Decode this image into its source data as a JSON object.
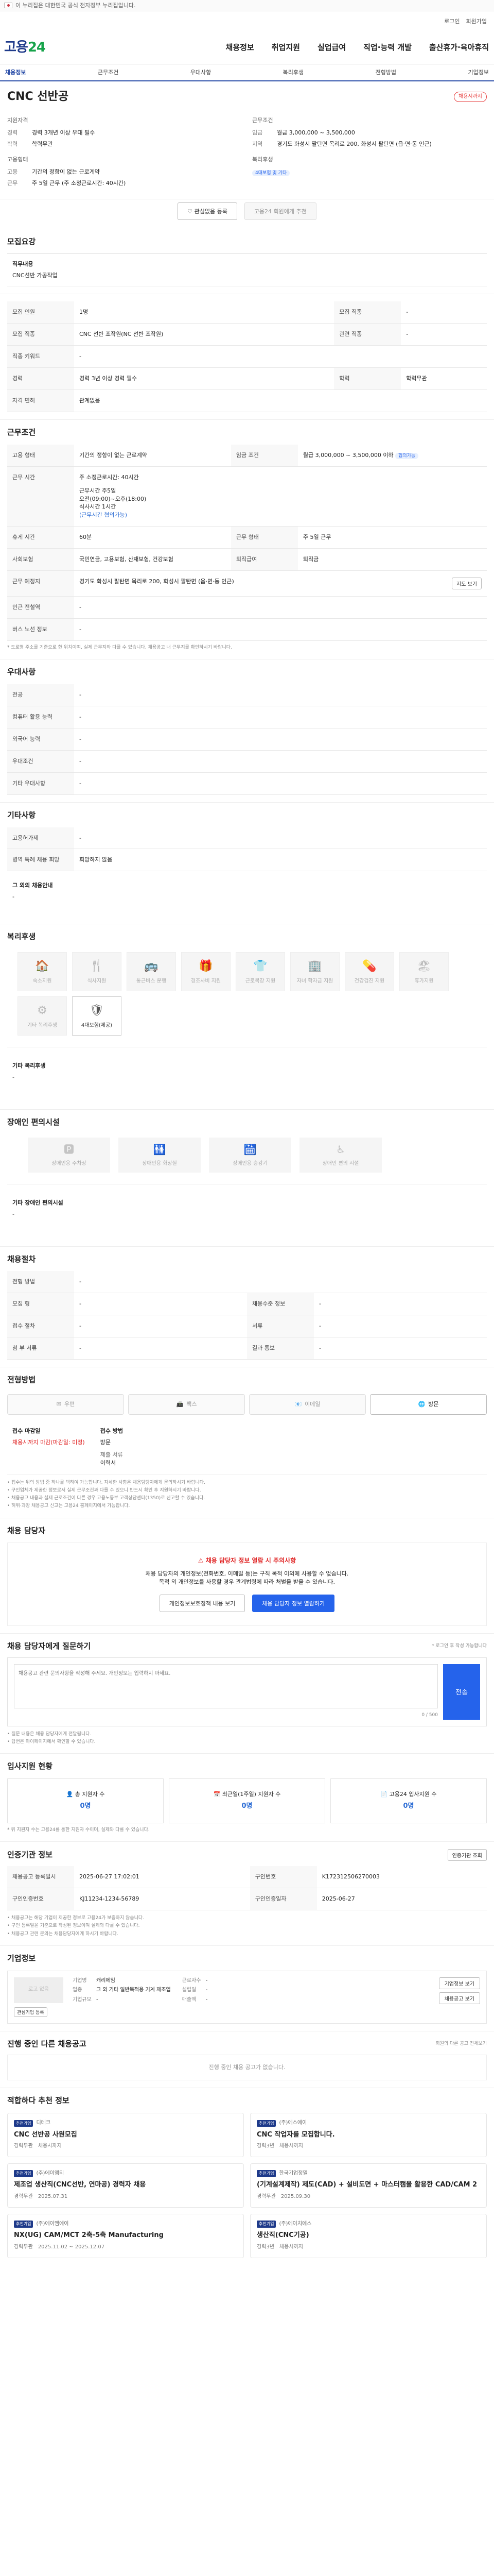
{
  "banner": {
    "text": "이 누리집은 대한민국 공식 전자정부 누리집입니다."
  },
  "util": {
    "links": [
      "로그인",
      "회원가입"
    ]
  },
  "header": {
    "logo_main": "고용",
    "logo_sub": "24",
    "gnb": [
      "채용정보",
      "취업지원",
      "실업급여",
      "직업·능력 개발",
      "출산휴가·육아휴직"
    ]
  },
  "tabs": [
    "채용정보",
    "근무조건",
    "우대사항",
    "복리후생",
    "전형방법",
    "기업정보"
  ],
  "job": {
    "title": "CNC 선반공",
    "deadline_badge": "채용시까지",
    "summary_left": {
      "heading": "지원자격",
      "rows": [
        {
          "k": "경력",
          "v": "경력 3개년 이상 우대 필수"
        },
        {
          "k": "학력",
          "v": "학력무관"
        }
      ],
      "heading2": "고용형태",
      "rows2": [
        {
          "k": "고용",
          "v": "기간의 정함이 없는 근로계약"
        },
        {
          "k": "근무",
          "v": "주 5일 근무 (주 소정근로시간: 40시간)"
        }
      ]
    },
    "summary_right": {
      "heading": "근무조건",
      "rows": [
        {
          "k": "임금",
          "v": "월급 3,000,000 ~ 3,500,000"
        },
        {
          "k": "지역",
          "v": "경기도 화성시 팔탄면 목리로 200, 화성시 팔탄면 (읍·면·동 인근)"
        }
      ],
      "heading2": "복리후생",
      "tag": "4대보험 및 기타"
    },
    "apply_button": "관심없음 등록",
    "interest_button": "고용24 회원에게 추천"
  },
  "duties": {
    "title": "모집요강",
    "label": "직무내용",
    "text": "CNC선반 가공작업"
  },
  "recruit_table": [
    {
      "h": "모집 인원",
      "v": "1명",
      "h2": "모집 직종",
      "v2": "-"
    },
    {
      "h": "모집 직종",
      "v": "CNC 선반 조작원(NC 선반 조작원)",
      "h2": "관련 직종",
      "v2": "-"
    },
    {
      "h": "직종 키워드",
      "v": "-",
      "h2": "",
      "v2": ""
    },
    {
      "h": "경력",
      "v": "경력 3년 이상 경력 필수",
      "h2": "학력",
      "v2": "학력무관"
    },
    {
      "h": "자격 면허",
      "v": "관계없음",
      "h2": "",
      "v2": ""
    }
  ],
  "conditions": {
    "title": "근무조건",
    "rows": [
      {
        "h": "고용 형태",
        "v": "기간의 정함이 없는 근로계약",
        "h2": "임금 조건",
        "v2": "월급 3,000,000 ~ 3,500,000 이하",
        "v2tag": "협의가능"
      },
      {
        "h": "근무 시간",
        "v": "주 소정근로시간: 40시간",
        "lines": [
          "근무시간 주5일",
          "오전(09:00)~오후(18:00)",
          "식사시간 1시간",
          "(근무시간 협의가능)"
        ],
        "h2": "",
        "v2": ""
      },
      {
        "h": "휴게 시간",
        "v": "60분",
        "h2": "근무 형태",
        "v2": "주 5일 근무"
      },
      {
        "h": "사회보험",
        "v": "국민연금, 고용보험, 산재보험, 건강보험",
        "h2": "퇴직급여",
        "v2": "퇴직금"
      },
      {
        "h": "근무 예정지",
        "v": "경기도 화성시 팔탄면 목리로 200, 화성시 팔탄면 (읍·면·동 인근)",
        "h2": "",
        "v2": "",
        "map_btn": "지도 보기"
      },
      {
        "h": "인근 전철역",
        "v": "-",
        "h2": "",
        "v2": ""
      },
      {
        "h": "버스 노선 정보",
        "v": "-",
        "h2": "",
        "v2": ""
      }
    ],
    "note": "* 도로명 주소를 기준으로 한 위치이며, 실제 근무지와 다를 수 있습니다. 채용공고 내 근무지를 확인하시기 바랍니다."
  },
  "preference": {
    "title": "우대사항",
    "rows": [
      {
        "h": "전공",
        "v": "-"
      },
      {
        "h": "컴퓨터 활용 능력",
        "v": "-"
      },
      {
        "h": "외국어 능력",
        "v": "-"
      },
      {
        "h": "우대조건",
        "v": "-"
      },
      {
        "h": "기타 우대사항",
        "v": "-"
      }
    ]
  },
  "extra": {
    "title": "기타사항",
    "rows": [
      {
        "h": "고용허가제",
        "v": "-"
      },
      {
        "h": "병역 특례 채용 희망",
        "v": "희망하지 않음"
      }
    ],
    "sub": "그 외의 채용안내",
    "sub_text": "-"
  },
  "welfare": {
    "title": "복리후생",
    "cards": [
      {
        "icon": "🏠",
        "name": "숙소지원",
        "on": false
      },
      {
        "icon": "🍴",
        "name": "식사지원",
        "on": false
      },
      {
        "icon": "🚌",
        "name": "통근버스 운행",
        "on": false
      },
      {
        "icon": "🎁",
        "name": "경조사비 지원",
        "on": false
      },
      {
        "icon": "👕",
        "name": "근로복장 지원",
        "on": false
      },
      {
        "icon": "🏢",
        "name": "자녀 학자금 지원",
        "on": false
      },
      {
        "icon": "💊",
        "name": "건강검진 지원",
        "on": false
      },
      {
        "icon": "🏖",
        "name": "휴가지원",
        "on": false
      },
      {
        "icon": "⚙",
        "name": "기타 복리후생",
        "on": false
      },
      {
        "icon": "🛡",
        "name": "4대보험(제공)",
        "on": true
      }
    ],
    "other_title": "기타 복리후생",
    "other_text": "-"
  },
  "disabled": {
    "title": "장애인 편의시설",
    "cards": [
      {
        "icon": "🅿",
        "name": "장애인용 주차장"
      },
      {
        "icon": "🚻",
        "name": "장애인용 화장실"
      },
      {
        "icon": "🛗",
        "name": "장애인용 승강기"
      },
      {
        "icon": "♿",
        "name": "장애인 편의 시설"
      }
    ],
    "other_title": "기타 장애인 편의시설",
    "other_text": "-"
  },
  "process": {
    "title": "채용절차",
    "rows": [
      {
        "h": "전형 방법",
        "v": "-",
        "h2": "",
        "v2": ""
      },
      {
        "h": "모집 형",
        "v": "-",
        "h2": "채용수준 정보",
        "v2": "-"
      },
      {
        "h": "접수 절차",
        "v": "-",
        "h2": "서류",
        "v2": "-"
      },
      {
        "h": "첨 부 서류",
        "v": "-",
        "h2": "결과 통보",
        "v2": "-"
      }
    ]
  },
  "method": {
    "title": "전형방법",
    "tabs": [
      {
        "icon": "✉",
        "label": "우편",
        "on": false
      },
      {
        "icon": "📠",
        "label": "팩스",
        "on": false
      },
      {
        "icon": "📧",
        "label": "이메일",
        "on": false
      },
      {
        "icon": "🌐",
        "label": "방문",
        "on": true
      }
    ],
    "left_label": "접수 마감일",
    "left_value": "채용시까지 마감(마감일: 미정)",
    "right_label": "접수 방법",
    "right_lines": [
      "방문",
      "제출 서류",
      "이력서"
    ],
    "notices": [
      "• 접수는 위의 방법 중 하나를 택하여 가능합니다. 자세한 사항은 채용담당자에게 문의하시기 바랍니다.",
      "• 구인업체가 제공한 정보로서 실제 근무조건과 다를 수 있으니 반드시 확인 후 지원하시기 바랍니다.",
      "• 채용공고 내용과 실제 근로조건이 다른 경우 고용노동부 고객상담센터(1350)로 신고할 수 있습니다.",
      "• 허위·과장 채용공고 신고는 고용24 홈페이지에서 가능합니다."
    ]
  },
  "contact": {
    "title": "채용 담당자",
    "alert": "채용 담당자 정보 열람 시 주의사항",
    "text1": "채용 담당자의 개인정보(전화번호, 이메일 등)는 구직 목적 이외에 사용할 수 없습니다.",
    "text2": "목적 외 개인정보를 사용할 경우 관계법령에 따라 처벌을 받을 수 있습니다.",
    "btn_ghost": "개인정보보호정책 내용 보기",
    "btn_primary": "채용 담당자 정보 열람하기"
  },
  "qa": {
    "title": "채용 담당자에게 질문하기",
    "link": "* 로그인 후 작성 가능합니다",
    "placeholder": "채용공고 관련 문의사항을 작성해 주세요. 개인정보는 입력하지 마세요.",
    "count": "0 / 500",
    "send": "전송",
    "notes": [
      "• 질문 내용은 채용 담당자에게 전달됩니다.",
      "• 답변은 마이페이지에서 확인할 수 있습니다."
    ]
  },
  "stats": {
    "title": "입사지원 현황",
    "items": [
      {
        "label": "총 지원자 수",
        "num": "0명"
      },
      {
        "label": "최근일(1주일) 지원자 수",
        "num": "0명"
      },
      {
        "label": "고용24 입사지원 수",
        "num": "0명"
      }
    ],
    "note": "* 위 지원자 수는 고용24를 통한 지원자 수이며, 실제와 다를 수 있습니다."
  },
  "registry": {
    "title": "인증기관 정보",
    "btn": "인증기관 조회",
    "rows": [
      {
        "h": "채용공고 등록일시",
        "v": "2025-06-27 17:02:01",
        "h2": "구인번호",
        "v2": "K172312506270003"
      },
      {
        "h": "구인인증번호",
        "v": "KJ11234-1234-56789",
        "h2": "구인인증일자",
        "v2": "2025-06-27"
      }
    ],
    "notes": [
      "• 채용공고는 해당 기업이 제공한 정보로 고용24가 보증하지 않습니다.",
      "• 구인 등록일을 기준으로 작성된 정보이며 실제와 다를 수 있습니다.",
      "• 채용공고 관련 문의는 채용담당자에게 하시기 바랍니다."
    ]
  },
  "company": {
    "title": "기업정보",
    "logo": "로고 없음",
    "c1": [
      {
        "k": "기업명",
        "v": "캐리에임"
      },
      {
        "k": "업종",
        "v": "그 외 기타 일반목적용 기계 제조업"
      },
      {
        "k": "기업규모",
        "v": "-"
      }
    ],
    "c2": [
      {
        "k": "근로자수",
        "v": "-"
      },
      {
        "k": "설립일",
        "v": "-"
      },
      {
        "k": "매출액",
        "v": "-"
      }
    ],
    "btn1": "관심기업 등록",
    "btn2": "기업정보 보기",
    "btn3": "채용공고 보기"
  },
  "same_company": {
    "title": "진행 중인 다른 채용공고",
    "link": "회원의 다른 공고 전체보기",
    "empty": "진행 중인 채용 공고가 없습니다."
  },
  "recommend": {
    "title": "적합하다 추천 정보",
    "cards": [
      {
        "tag": "추천기업",
        "company": "디테크",
        "title": "CNC 선반공 사원모집",
        "meta": [
          "경력무관",
          "채용시까지"
        ]
      },
      {
        "tag": "추천기업",
        "company": "(주)에스에이",
        "title": "CNC 작업자를 모집합니다.",
        "meta": [
          "경력3년",
          "채용시까지"
        ]
      },
      {
        "tag": "추천기업",
        "company": "(주)에이엠티",
        "title": "제조업 생산직(CNC선반, 연마공) 경력자 채용",
        "meta": [
          "경력무관",
          "2025.07.31"
        ]
      },
      {
        "tag": "추천기업",
        "company": "한국기업정밀",
        "title": "(기계설계제작) 제도(CAD) + 설비도면 + 마스터캠을 활용한 CAD/CAM 2",
        "meta": [
          "경력무관",
          "2025.09.30"
        ]
      },
      {
        "tag": "추천기업",
        "company": "(주)에이엠에이",
        "title": "NX(UG) CAM/MCT 2축-5축 Manufacturing",
        "meta": [
          "경력무관",
          "2025.11.02 ~ 2025.12.07"
        ]
      },
      {
        "tag": "추천기업",
        "company": "(주)에이치에스",
        "title": "생산직(CNC기공)",
        "meta": [
          "경력3년",
          "채용시까지"
        ]
      }
    ]
  }
}
